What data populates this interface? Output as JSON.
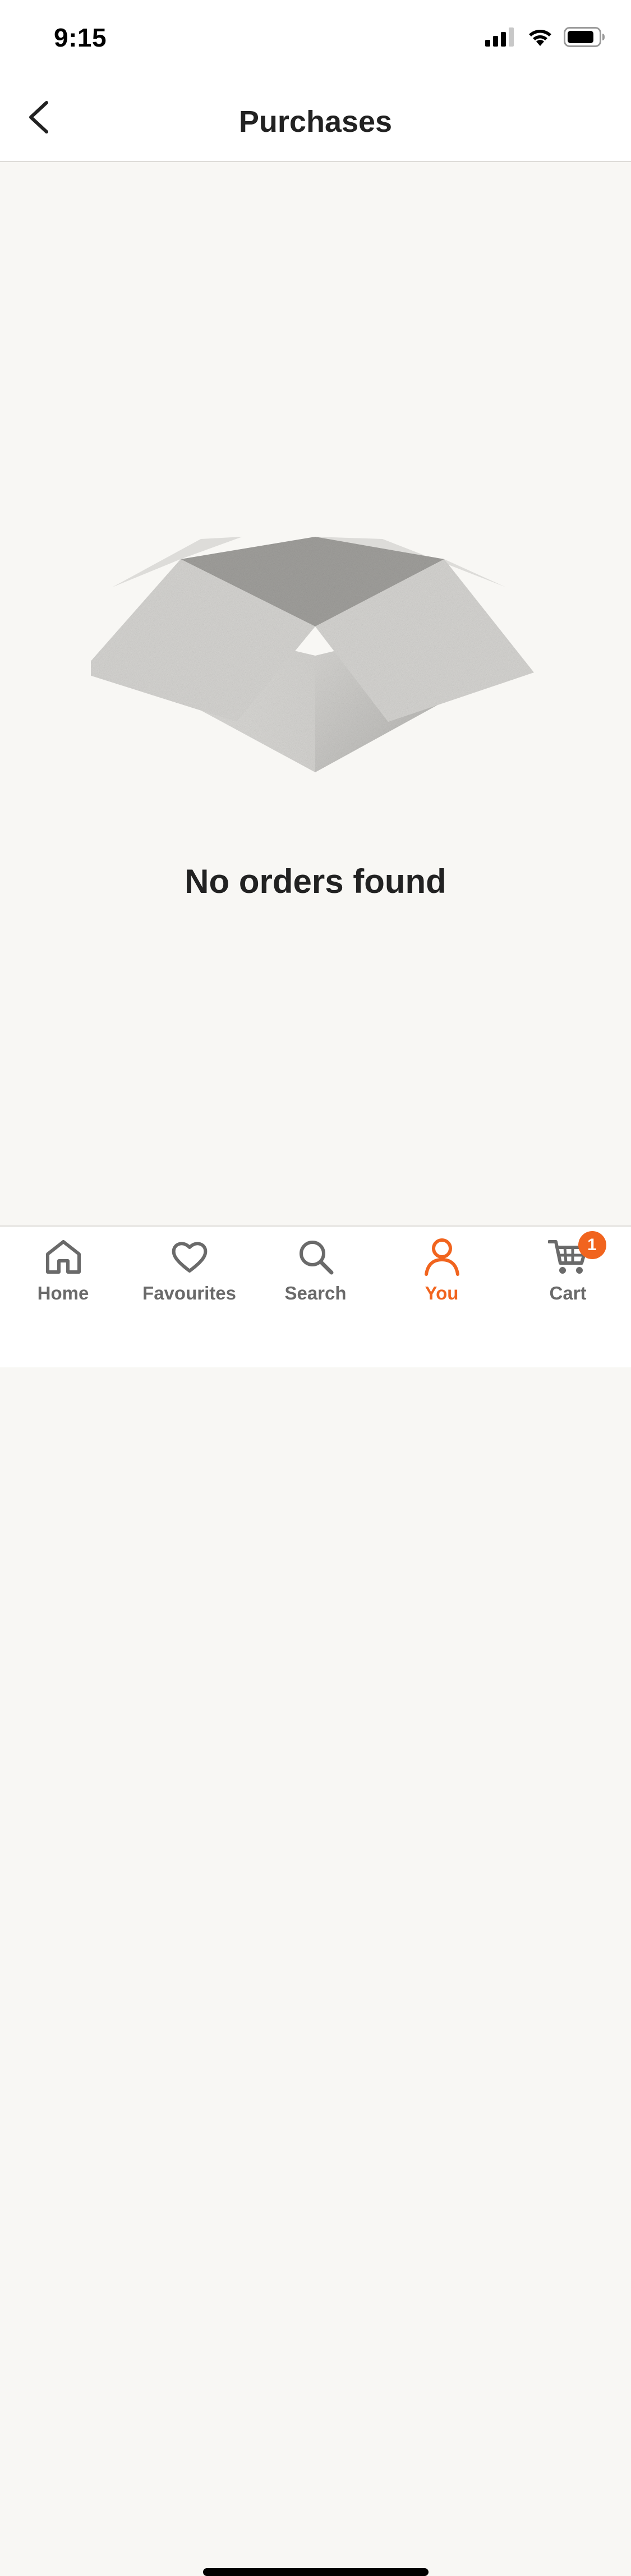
{
  "status_bar": {
    "time": "9:15",
    "icons": [
      "cellular-signal-icon",
      "wifi-icon",
      "battery-icon"
    ]
  },
  "header": {
    "title": "Purchases",
    "back_icon": "chevron-left-icon"
  },
  "empty_state": {
    "illustration": "open-box-illustration",
    "message": "No orders found"
  },
  "tab_bar": {
    "tabs": [
      {
        "label": "Home",
        "icon": "home-icon",
        "active": false
      },
      {
        "label": "Favourites",
        "icon": "heart-icon",
        "active": false
      },
      {
        "label": "Search",
        "icon": "search-icon",
        "active": false
      },
      {
        "label": "You",
        "icon": "person-icon",
        "active": true
      },
      {
        "label": "Cart",
        "icon": "cart-icon",
        "active": false,
        "badge": "1"
      }
    ]
  },
  "colors": {
    "accent": "#f1641e",
    "background": "#f8f7f4",
    "text": "#222222",
    "inactive_tab": "#6a6a6a"
  }
}
